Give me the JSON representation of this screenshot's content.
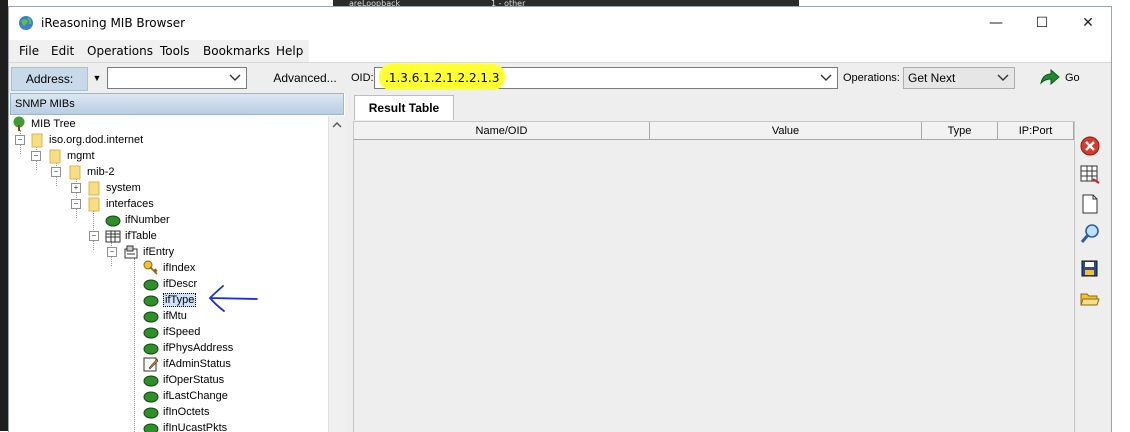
{
  "background_tabs": [
    {
      "label": "areLoopback"
    },
    {
      "label": "1 - other"
    }
  ],
  "window": {
    "title": "iReasoning MIB Browser",
    "controls": {
      "minimize": "—",
      "maximize": "☐",
      "close": "✕"
    }
  },
  "menu": [
    "File",
    "Edit",
    "Operations",
    "Tools",
    "Bookmarks",
    "Help"
  ],
  "toolbar": {
    "address_label": "Address:",
    "address_value": "",
    "advanced_label": "Advanced...",
    "oid_label": "OID:",
    "oid_value": ".1.3.6.1.2.1.2.2.1.3",
    "operations_label": "Operations:",
    "operations_value": "Get Next",
    "go_label": "Go"
  },
  "left_panel": {
    "header": "SNMP MIBs",
    "tree": [
      {
        "label": "MIB Tree",
        "icon": "tree-icon"
      },
      {
        "label": "iso.org.dod.internet",
        "icon": "folder-icon"
      },
      {
        "label": "mgmt",
        "icon": "folder-icon"
      },
      {
        "label": "mib-2",
        "icon": "folder-icon"
      },
      {
        "label": "system",
        "icon": "folder-icon"
      },
      {
        "label": "interfaces",
        "icon": "folder-icon"
      },
      {
        "label": "ifNumber",
        "icon": "leaf-icon"
      },
      {
        "label": "ifTable",
        "icon": "table-icon"
      },
      {
        "label": "ifEntry",
        "icon": "entry-icon"
      },
      {
        "label": "ifIndex",
        "icon": "key-icon"
      },
      {
        "label": "ifDescr",
        "icon": "leaf-icon"
      },
      {
        "label": "ifType",
        "icon": "leaf-icon",
        "selected": true
      },
      {
        "label": "ifMtu",
        "icon": "leaf-icon"
      },
      {
        "label": "ifSpeed",
        "icon": "leaf-icon"
      },
      {
        "label": "ifPhysAddress",
        "icon": "leaf-icon"
      },
      {
        "label": "ifAdminStatus",
        "icon": "writable-leaf-icon"
      },
      {
        "label": "ifOperStatus",
        "icon": "leaf-icon"
      },
      {
        "label": "ifLastChange",
        "icon": "leaf-icon"
      },
      {
        "label": "ifInOctets",
        "icon": "leaf-icon"
      },
      {
        "label": "ifInUcastPkts",
        "icon": "leaf-icon"
      }
    ]
  },
  "right_panel": {
    "tab": "Result Table",
    "columns": [
      "Name/OID",
      "Value",
      "Type",
      "IP:Port"
    ],
    "side_icons": [
      "delete-icon",
      "table-view-icon",
      "document-icon",
      "find-icon",
      "save-icon",
      "open-folder-icon"
    ]
  },
  "colors": {
    "highlight": "#ffff33",
    "selection": "#cfe3fb",
    "annotation": "#1a2fd6"
  }
}
